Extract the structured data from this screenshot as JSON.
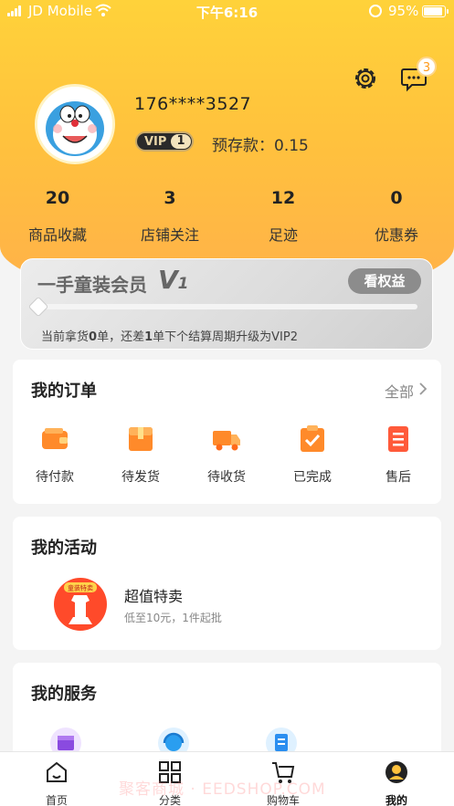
{
  "status_bar": {
    "carrier": "JD Mobile",
    "time": "下午6:16",
    "battery": "95%"
  },
  "header": {
    "message_badge": "3",
    "icons": [
      "gear-icon",
      "chat-bubble-icon"
    ]
  },
  "profile": {
    "phone": "176****3527",
    "vip_badge_text": "VIP",
    "vip_badge_level": "1",
    "deposit_label": "预存款：",
    "deposit_value": "0.15"
  },
  "stats": [
    {
      "value": "20",
      "label": "商品收藏"
    },
    {
      "value": "3",
      "label": "店铺关注"
    },
    {
      "value": "12",
      "label": "足迹"
    },
    {
      "value": "0",
      "label": "优惠券"
    }
  ],
  "vip_card": {
    "title": "一手童装会员",
    "level_prefix": "V",
    "level_num": "1",
    "button": "看权益",
    "progress": 0,
    "desc_1": "当前拿货",
    "desc_2": "0",
    "desc_3": "单，还差",
    "desc_4": "1",
    "desc_5": "单下个结算周期升级为VIP2"
  },
  "orders": {
    "title": "我的订单",
    "all_label": "全部",
    "items": [
      {
        "label": "待付款",
        "icon": "wallet-icon"
      },
      {
        "label": "待发货",
        "icon": "package-icon"
      },
      {
        "label": "待收货",
        "icon": "truck-icon"
      },
      {
        "label": "已完成",
        "icon": "clipboard-check-icon"
      },
      {
        "label": "售后",
        "icon": "list-document-icon"
      }
    ]
  },
  "activity": {
    "title": "我的活动",
    "item_badge": "童装特卖",
    "item_title": "超值特卖",
    "item_subtitle": "低至10元，1件起批"
  },
  "services": {
    "title": "我的服务",
    "icons": [
      "store-icon",
      "customer-service-icon",
      "document-edit-icon"
    ]
  },
  "tabbar": {
    "tabs": [
      {
        "label": "首页",
        "icon": "home-icon"
      },
      {
        "label": "分类",
        "icon": "grid-icon"
      },
      {
        "label": "购物车",
        "icon": "cart-icon"
      },
      {
        "label": "我的",
        "icon": "profile-icon",
        "active": true
      }
    ]
  },
  "watermark": "聚客商城 · EEDSHOP.COM",
  "colors": {
    "accent": "#ffc23d",
    "badge_orange": "#ff9a1a",
    "icon_orange": "#ff8a2a"
  }
}
